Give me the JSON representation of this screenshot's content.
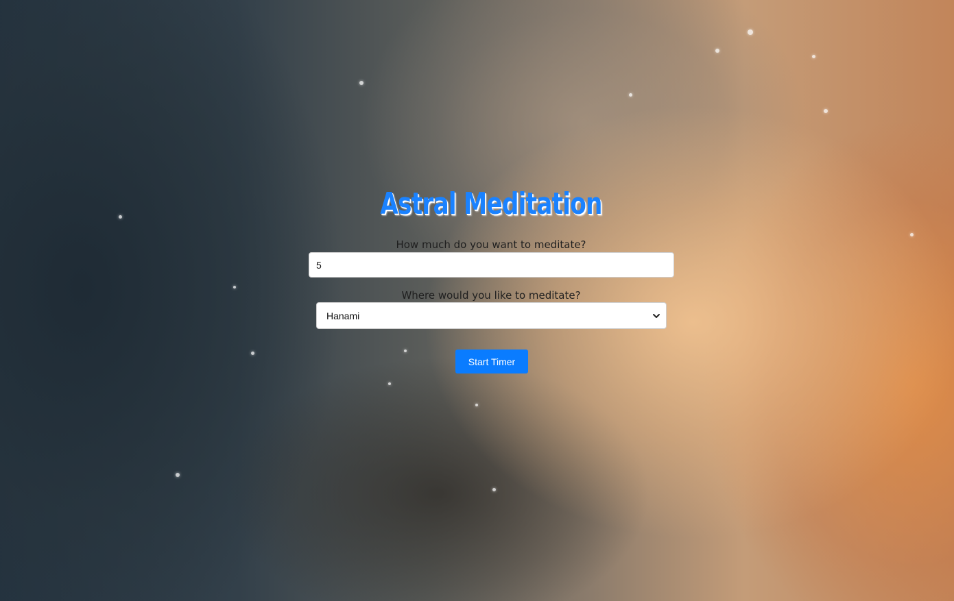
{
  "app": {
    "title": "Astral Meditation"
  },
  "form": {
    "duration_label": "How much do you want to meditate?",
    "duration_value": "5",
    "location_label": "Where would you like to meditate?",
    "location_selected": "Hanami",
    "start_button_label": "Start Timer"
  },
  "icons": {
    "select_arrow": "chevron-down-icon"
  },
  "colors": {
    "accent": "#0a7cff",
    "title": "#1a82ff"
  }
}
